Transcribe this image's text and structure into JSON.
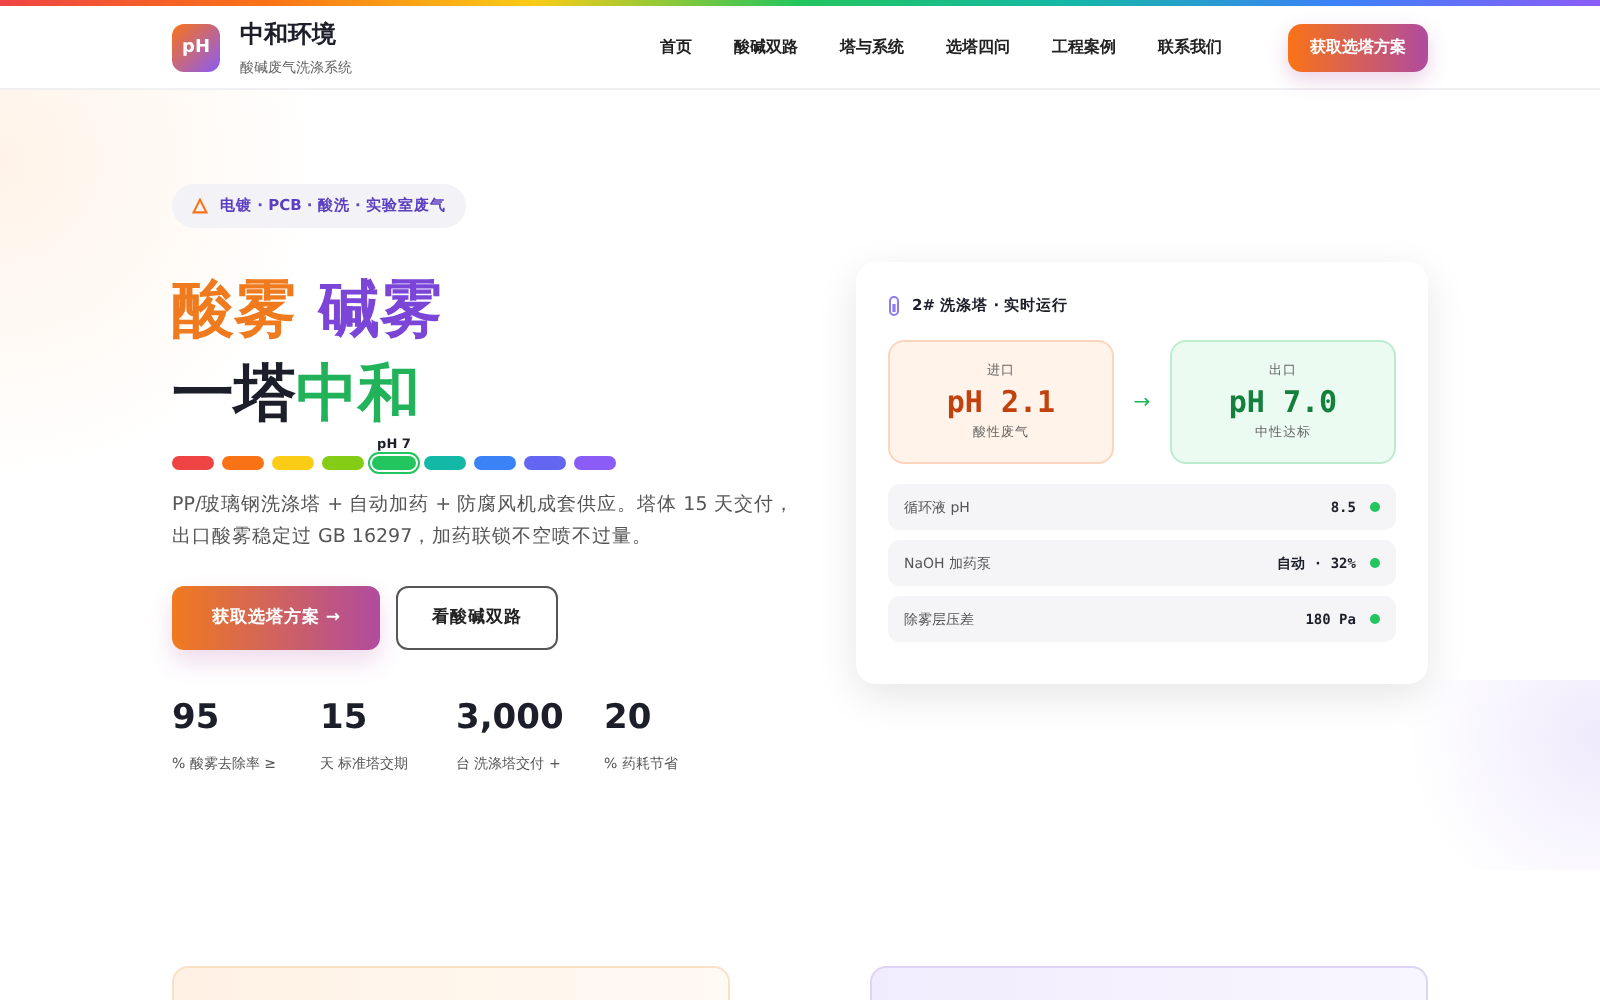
{
  "brand": {
    "logo": "pH",
    "name": "中和环境",
    "tagline": "酸碱废气洗涤系统"
  },
  "nav": {
    "links": [
      "首页",
      "酸碱双路",
      "塔与系统",
      "选塔四问",
      "工程案例",
      "联系我们"
    ],
    "cta": "获取选塔方案"
  },
  "hero": {
    "badge": "电镀 · PCB · 酸洗 · 实验室废气",
    "title_line1": [
      {
        "text": "酸雾",
        "color": "#f07a1e"
      },
      {
        "text": "碱雾",
        "color": "#7b45d8"
      }
    ],
    "title_line2": [
      {
        "text": "一塔",
        "color": "#1c1f2a"
      },
      {
        "text": "中和",
        "color": "#22b35a"
      }
    ],
    "scale_label": "pH 7",
    "scale": [
      {
        "color": "#ef4444",
        "selected": false
      },
      {
        "color": "#f97316",
        "selected": false
      },
      {
        "color": "#facc15",
        "selected": false
      },
      {
        "color": "#84cc16",
        "selected": false
      },
      {
        "color": "#22c55e",
        "selected": true
      },
      {
        "color": "#14b8a6",
        "selected": false
      },
      {
        "color": "#3b82f6",
        "selected": false
      },
      {
        "color": "#6366f1",
        "selected": false
      },
      {
        "color": "#8b5cf6",
        "selected": false
      }
    ],
    "description": "PP/玻璃钢洗涤塔 + 自动加药 + 防腐风机成套供应。塔体 15 天交付，出口酸雾稳定过 GB 16297，加药联锁不空喷不过量。",
    "primary_button": "获取选塔方案 →",
    "secondary_button": "看酸碱双路",
    "stats": [
      {
        "value": "95",
        "label": "% 酸雾去除率 ≥"
      },
      {
        "value": "15",
        "label": "天 标准塔交期"
      },
      {
        "value": "3,000",
        "label": "台 洗涤塔交付 +"
      },
      {
        "value": "20",
        "label": "% 药耗节省"
      }
    ]
  },
  "monitor": {
    "title": "2# 洗涤塔 · 实时运行",
    "inlet": {
      "label": "进口",
      "value": "pH 2.1",
      "note": "酸性废气"
    },
    "arrow": "→",
    "outlet": {
      "label": "出口",
      "value": "pH 7.0",
      "note": "中性达标"
    },
    "rows": [
      {
        "label": "循环液 pH",
        "value": "8.5",
        "color": "#22c55e"
      },
      {
        "label": "NaOH 加药泵",
        "value": "自动 · 32%",
        "color": "#22c55e"
      },
      {
        "label": "除雾层压差",
        "value": "180 Pa",
        "color": "#22c55e"
      }
    ]
  }
}
